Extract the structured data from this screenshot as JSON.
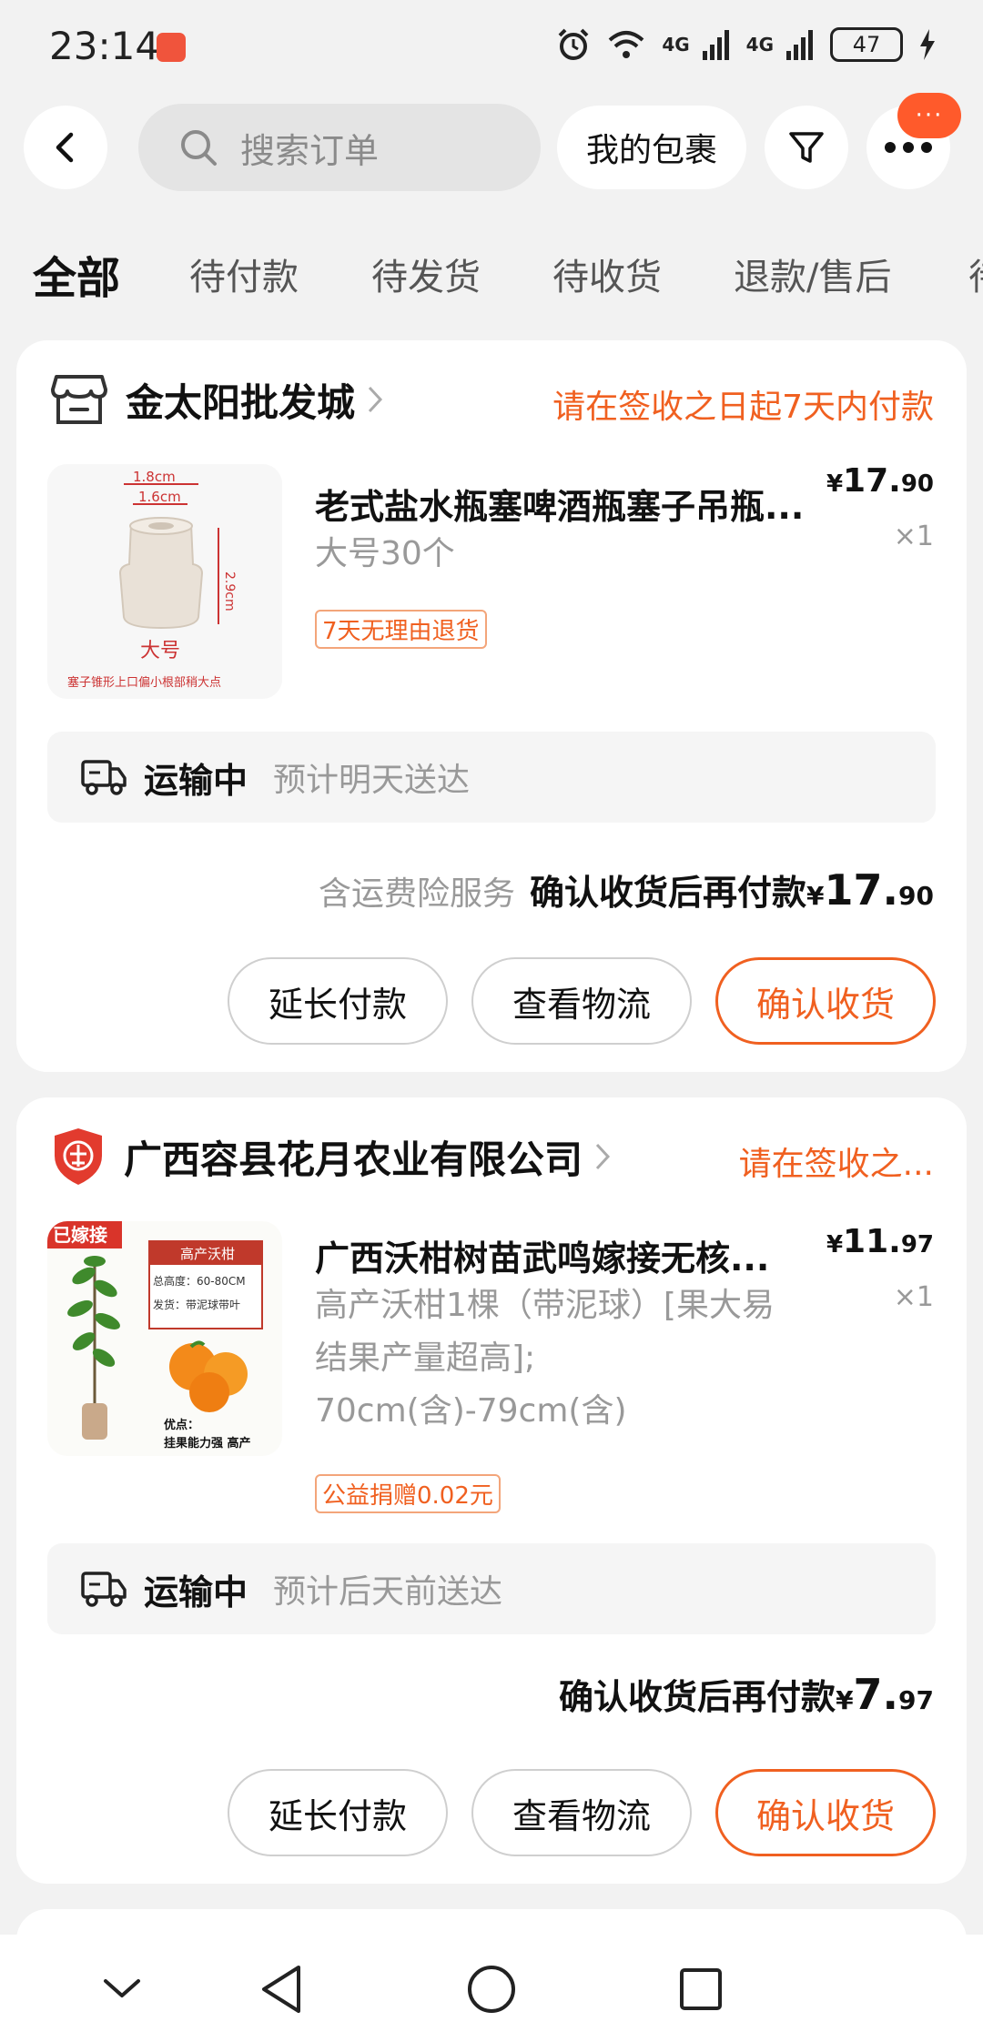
{
  "status_bar": {
    "time": "23:14",
    "net_label_1": "4G",
    "net_label_2": "4G",
    "battery": "47"
  },
  "header": {
    "search_placeholder": "搜索订单",
    "package_label": "我的包裹",
    "badge": "···"
  },
  "tabs": [
    "全部",
    "待付款",
    "待发货",
    "待收货",
    "退款/售后",
    "待"
  ],
  "orders": [
    {
      "shop_name": "金太阳批发城",
      "shop_note": "请在签收之日起7天内付款",
      "item_title": "老式盐水瓶塞啤酒瓶塞子吊瓶...",
      "item_spec": "大号30个",
      "item_tag": "7天无理由退货",
      "price_currency": "¥",
      "price_int": "17.",
      "price_dec": "90",
      "qty": "×1",
      "thumb_label_top": "1.8cm",
      "thumb_label_mid": "1.6cm",
      "thumb_label_side": "2.9cm",
      "thumb_label_size": "大号",
      "thumb_caption": "塞子锥形上口偏小根部稍大点",
      "ship_status": "运输中",
      "ship_eta": "预计明天送达",
      "total_extra": "含运费险服务",
      "total_label": "确认收货后再付款",
      "total_currency": "¥",
      "total_int": "17.",
      "total_dec": "90",
      "buttons": [
        "延长付款",
        "查看物流",
        "确认收货"
      ]
    },
    {
      "shop_name": "广西容县花月农业有限公司",
      "shop_note": "请在签收之...",
      "item_title": "广西沃柑树苗武鸣嫁接无核...",
      "item_spec_lines": [
        "高产沃柑1棵（带泥球）[果大易",
        "结果产量超高];",
        "70cm(含)-79cm(含)"
      ],
      "item_tag": "公益捐赠0.02元",
      "price_currency": "¥",
      "price_int": "11.",
      "price_dec": "97",
      "qty": "×1",
      "thumb_badge": "已嫁接",
      "thumb_title": "高产沃柑",
      "thumb_height": "总高度：60-80CM",
      "thumb_ship": "发货：带泥球带叶",
      "thumb_adv_label": "优点：",
      "thumb_adv": "挂果能力强 高产",
      "ship_status": "运输中",
      "ship_eta": "预计后天前送达",
      "total_label": "确认收货后再付款",
      "total_currency": "¥",
      "total_int": "7.",
      "total_dec": "97",
      "buttons": [
        "延长付款",
        "查看物流",
        "确认收货"
      ]
    }
  ],
  "colors": {
    "accent": "#f06020",
    "background": "#f2f2f2",
    "card": "#ffffff"
  },
  "icons": {
    "nav": [
      "chevron-down-icon",
      "back-triangle-icon",
      "home-circle-icon",
      "recents-square-icon"
    ]
  }
}
